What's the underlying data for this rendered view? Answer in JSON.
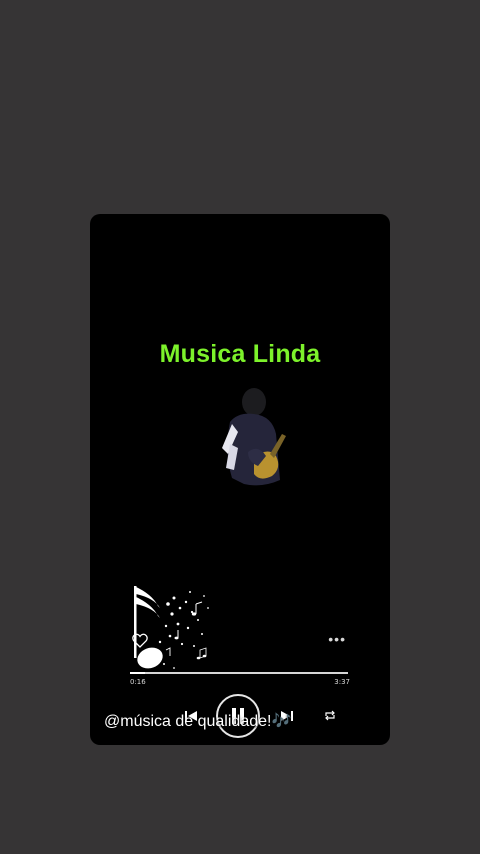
{
  "video": {
    "title": "Musica Linda",
    "title_color": "#7df22b",
    "caption": "@música de qualidade!🎶"
  },
  "player": {
    "elapsed": "0:16",
    "total": "3:37",
    "progress": 0.07,
    "state": "playing",
    "icons": {
      "like": "heart-icon",
      "more": "more-icon",
      "previous": "previous-icon",
      "pause": "pause-icon",
      "next": "next-icon",
      "repeat": "repeat-icon"
    }
  }
}
